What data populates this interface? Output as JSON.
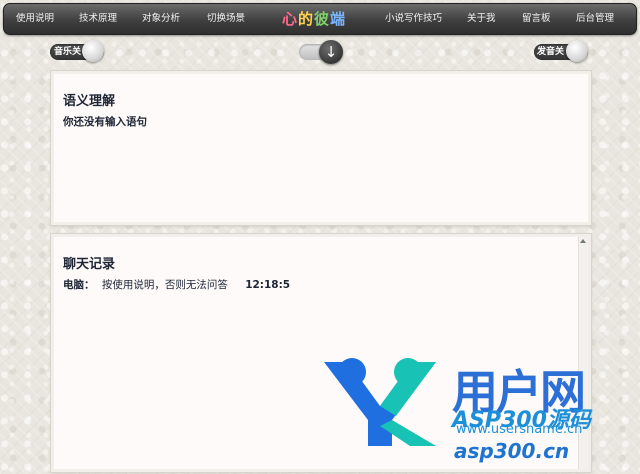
{
  "nav": {
    "items": [
      "使用说明",
      "技术原理",
      "对象分析",
      "切换场景",
      "小说写作技巧",
      "关于我",
      "留言板",
      "后台管理"
    ],
    "title_chars": [
      "心",
      "的",
      "彼",
      "端"
    ],
    "title_colors": [
      "#ff6a8a",
      "#ffd24a",
      "#7fd06a",
      "#7ab6ff"
    ]
  },
  "toggles": {
    "music_label": "音乐关",
    "voice_label": "发音关",
    "center_icon": "down-arrow-icon"
  },
  "semantic_panel": {
    "title": "语义理解",
    "text": "你还没有输入语句"
  },
  "chat_panel": {
    "title": "聊天记录",
    "messages": [
      {
        "speaker": "电脑：",
        "text": "按使用说明，否则无法问答",
        "time": "12:18:5"
      }
    ]
  },
  "watermark": {
    "brand": "用户网",
    "asp": "ASP300源码",
    "url1": "www.usersname.cn",
    "url2": "asp300.cn"
  }
}
